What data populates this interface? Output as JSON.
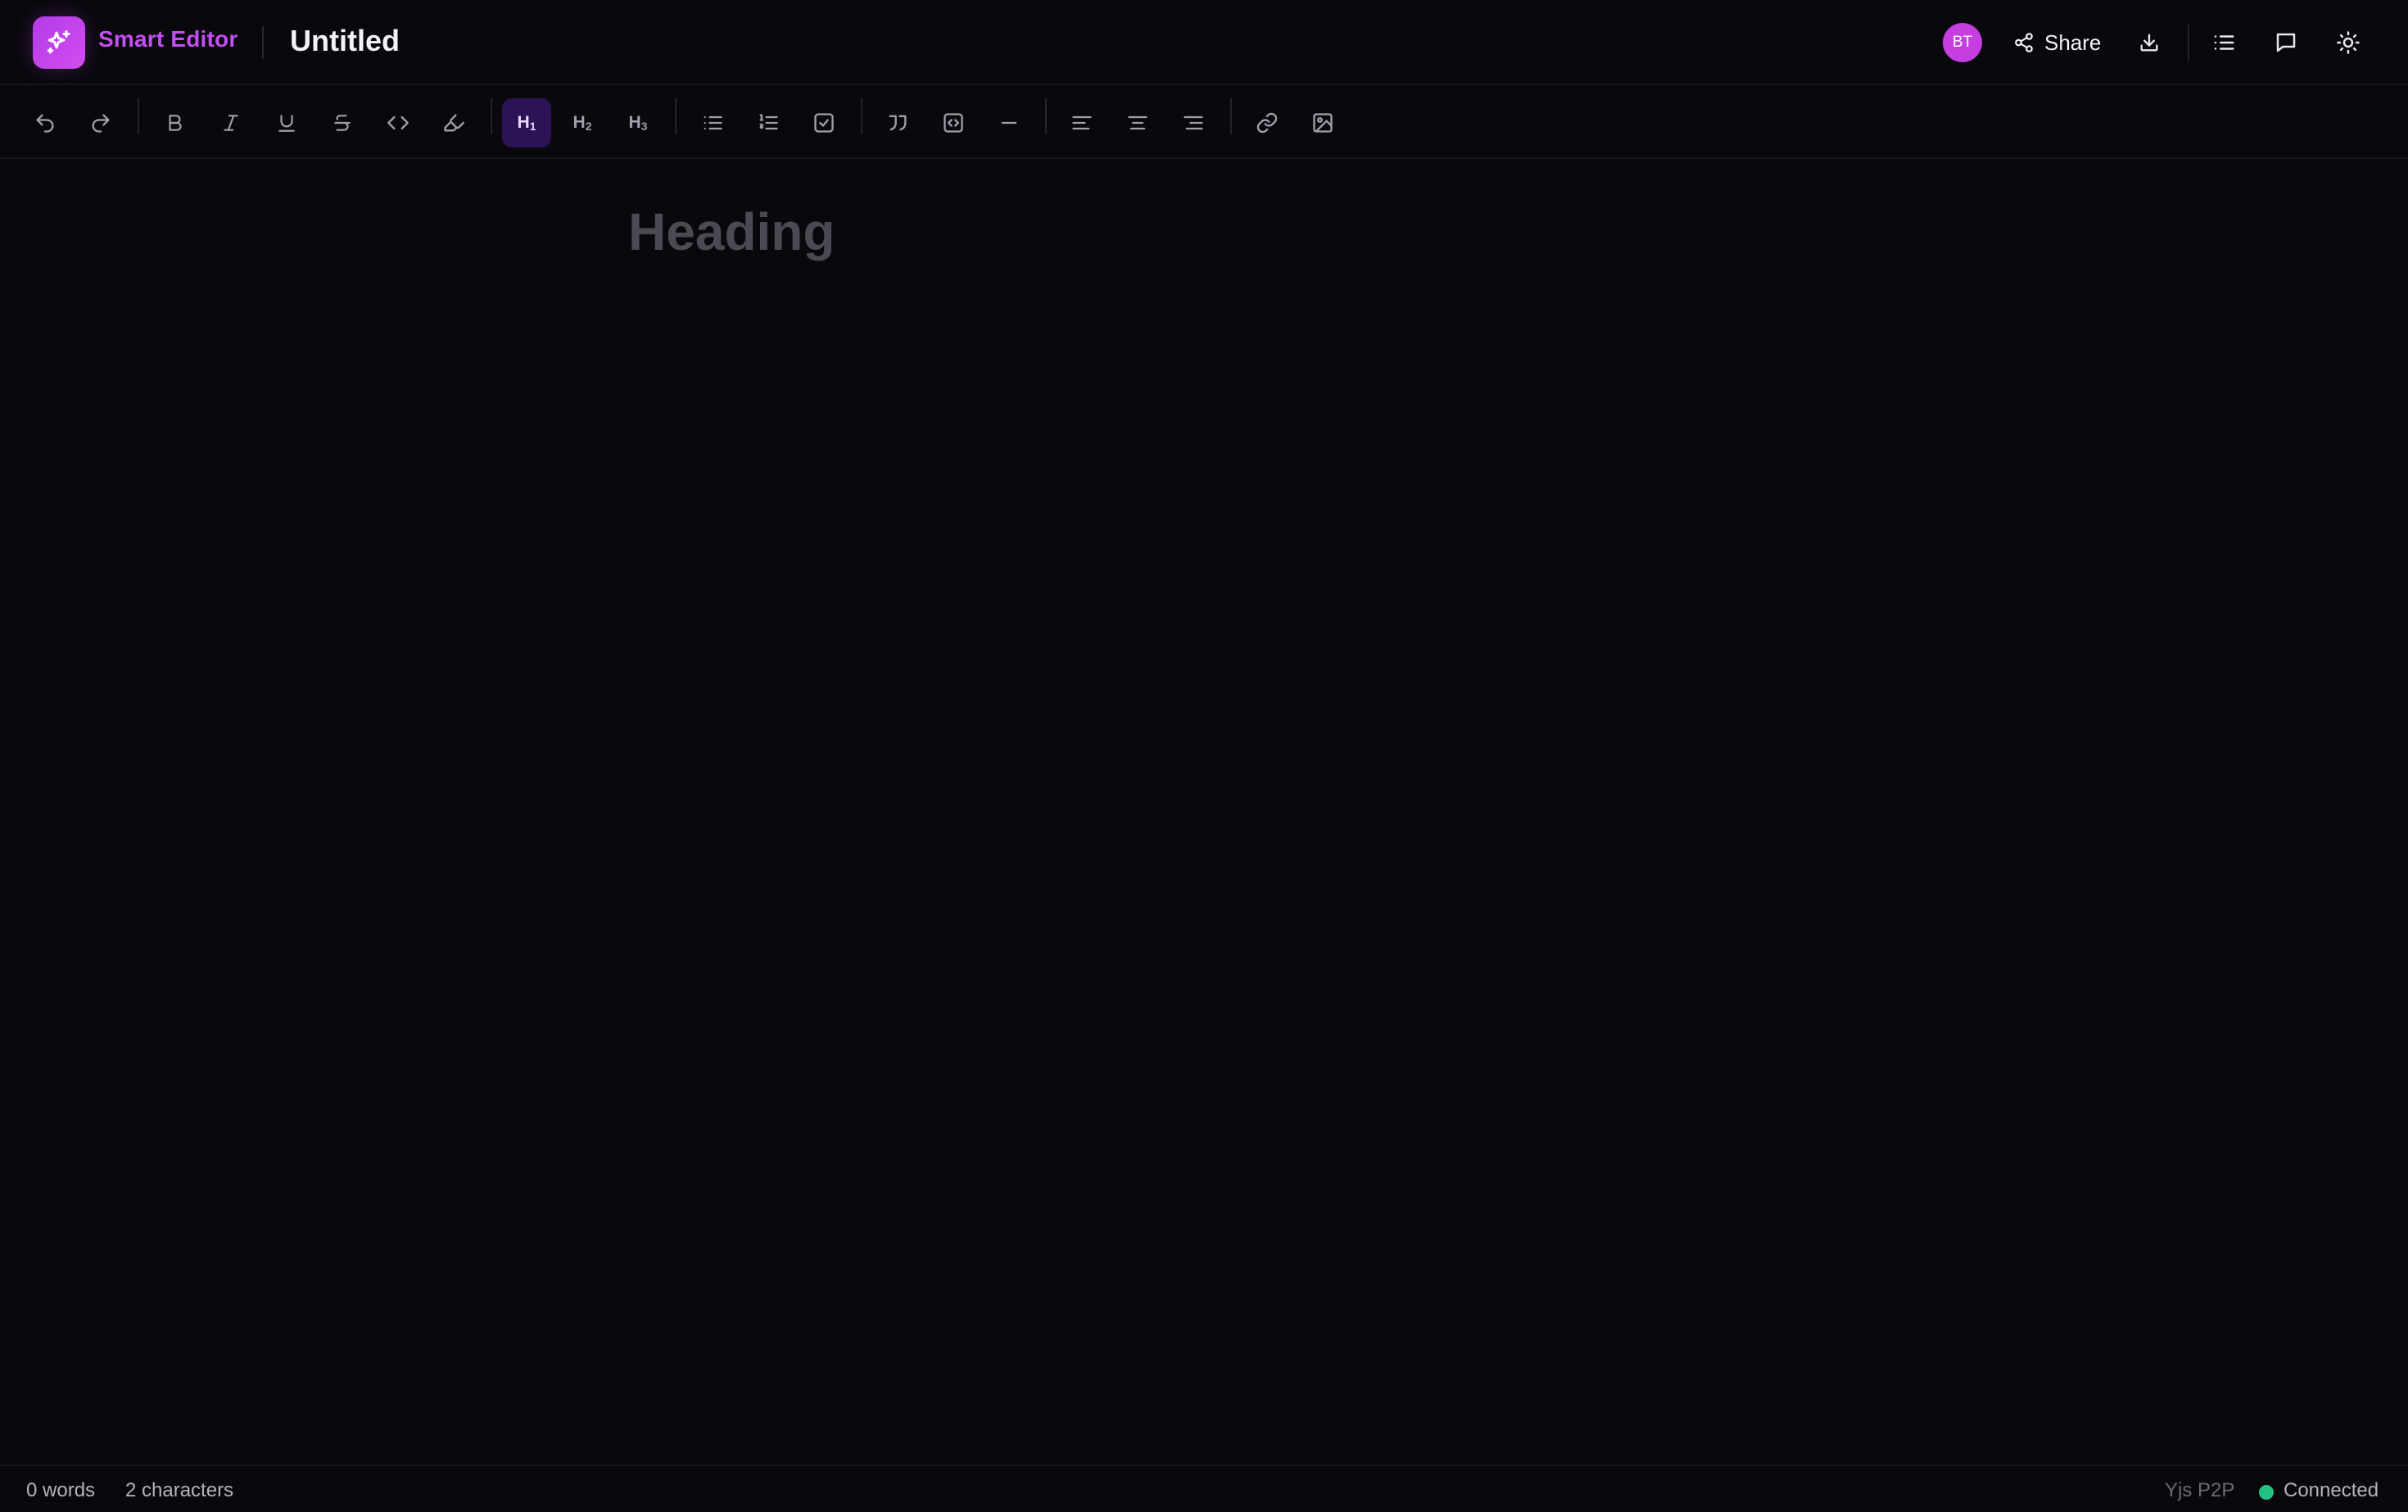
{
  "header": {
    "brand": "Smart Editor",
    "document_title": "Untitled",
    "avatar_initials": "BT",
    "share_label": "Share",
    "icons": [
      "download-icon",
      "outline-list-icon",
      "comment-icon",
      "sun-icon"
    ]
  },
  "toolbar": {
    "headings": {
      "h1_main": "H",
      "h1_sub": "1",
      "h2_main": "H",
      "h2_sub": "2",
      "h3_main": "H",
      "h3_sub": "3"
    },
    "active": "heading-1",
    "groups": [
      [
        "undo-icon",
        "redo-icon"
      ],
      [
        "bold-icon",
        "italic-icon",
        "underline-icon",
        "strikethrough-icon",
        "code-icon",
        "highlight-icon"
      ],
      [
        "heading-1",
        "heading-2",
        "heading-3"
      ],
      [
        "bullet-list-icon",
        "ordered-list-icon",
        "task-list-icon"
      ],
      [
        "blockquote-icon",
        "code-block-icon",
        "horizontal-rule-icon"
      ],
      [
        "align-left-icon",
        "align-center-icon",
        "align-right-icon"
      ],
      [
        "link-icon",
        "image-icon"
      ]
    ]
  },
  "editor": {
    "placeholder": "Heading"
  },
  "status": {
    "words": "0 words",
    "characters": "2 characters",
    "provider": "Yjs P2P",
    "connection": "Connected"
  },
  "colors": {
    "background": "#09080d",
    "accent": "#c24ff0",
    "active_button": "#2d1356",
    "connected": "#23c283"
  }
}
